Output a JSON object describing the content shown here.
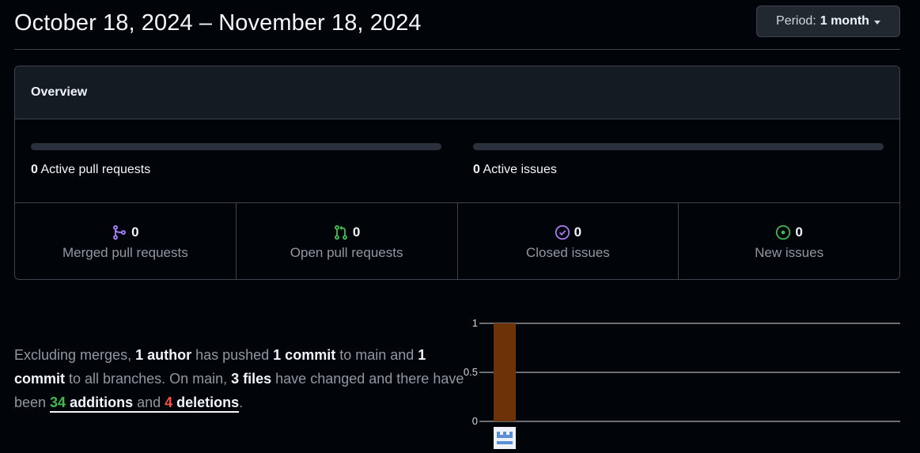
{
  "header": {
    "title": "October 18, 2024 – November 18, 2024",
    "period_label": "Period:",
    "period_value": "1 month"
  },
  "overview": {
    "title": "Overview",
    "active_prs": {
      "count": "0",
      "label": "Active pull requests"
    },
    "active_issues": {
      "count": "0",
      "label": "Active issues"
    },
    "stats": [
      {
        "icon": "git-merge-icon",
        "count": "0",
        "label": "Merged pull requests",
        "color": "#ab7df8"
      },
      {
        "icon": "git-pull-request-icon",
        "count": "0",
        "label": "Open pull requests",
        "color": "#3fb950"
      },
      {
        "icon": "issue-closed-icon",
        "count": "0",
        "label": "Closed issues",
        "color": "#ab7df8"
      },
      {
        "icon": "issue-opened-icon",
        "count": "0",
        "label": "New issues",
        "color": "#3fb950"
      }
    ]
  },
  "summary": {
    "p1": "Excluding merges, ",
    "authors": "1 author",
    "p2": " has pushed ",
    "commits_main": "1 commit",
    "p3": " to main and ",
    "commits_all": "1 commit",
    "p4": " to all branches. On main, ",
    "files": "3 files",
    "p5": " have changed and there have been ",
    "additions_count": "34",
    "additions_label": " additions",
    "and_text": " and ",
    "deletions_count": "4",
    "deletions_label": " deletions",
    "p6": "."
  },
  "chart_data": {
    "type": "bar",
    "categories": [
      "author-avatar"
    ],
    "values": [
      1
    ],
    "ylim": [
      0,
      1
    ],
    "yticks": [
      "0",
      "0.5",
      "1"
    ],
    "bar_color": "#6e3208",
    "grid": true
  }
}
